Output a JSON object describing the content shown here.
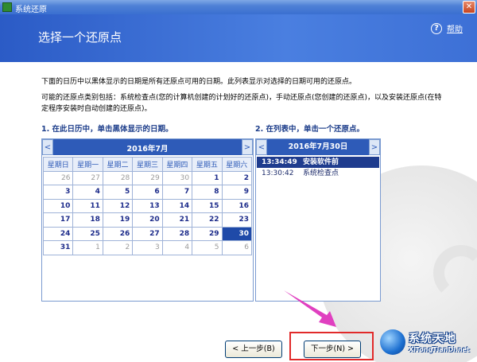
{
  "window": {
    "title": "系统还原"
  },
  "header": {
    "page_title": "选择一个还原点",
    "help_label": "帮助"
  },
  "description": {
    "line1": "下面的日历中以黑体显示的日期是所有还原点可用的日期。此列表显示对选择的日期可用的还原点。",
    "line2": "可能的还原点类别包括：系统检查点(您的计算机创建的计划好的还原点)，手动还原点(您创建的还原点)，以及安装还原点(在特定程序安装时自动创建的还原点)。"
  },
  "calendar": {
    "step_label": "1. 在此日历中，单击黑体显示的日期。",
    "month": "2016年7月",
    "weekdays": [
      "星期日",
      "星期一",
      "星期二",
      "星期三",
      "星期四",
      "星期五",
      "星期六"
    ],
    "weeks": [
      [
        "26",
        "27",
        "28",
        "29",
        "30",
        "1",
        "2"
      ],
      [
        "3",
        "4",
        "5",
        "6",
        "7",
        "8",
        "9"
      ],
      [
        "10",
        "11",
        "12",
        "13",
        "14",
        "15",
        "16"
      ],
      [
        "17",
        "18",
        "19",
        "20",
        "21",
        "22",
        "23"
      ],
      [
        "24",
        "25",
        "26",
        "27",
        "28",
        "29",
        "30"
      ],
      [
        "31",
        "1",
        "2",
        "3",
        "4",
        "5",
        "6"
      ]
    ],
    "selected_day": "30"
  },
  "restore_points": {
    "step_label": "2. 在列表中，单击一个还原点。",
    "date": "2016年7月30日",
    "items": [
      {
        "time": "13:34:49",
        "name": "安装软件前",
        "selected": true
      },
      {
        "time": "13:30:42",
        "name": "系统检查点",
        "selected": false
      }
    ]
  },
  "buttons": {
    "back": "< 上一步(B)",
    "next": "下一步(N) >"
  },
  "watermark": {
    "name": "系统天地",
    "url": "XiTongTianDi.net"
  },
  "colors": {
    "header": "#2b5bc6",
    "selection": "#1f4aa8",
    "highlight_box": "#e12a2a",
    "arrow": "#e040c0"
  }
}
